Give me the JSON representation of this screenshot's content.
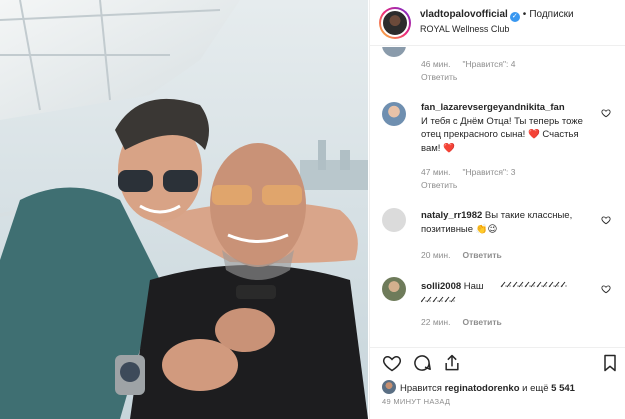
{
  "header": {
    "username": "vladtopalovofficial",
    "verified_mark": "✓",
    "dot": "•",
    "follow_label": "Подписки",
    "location": "ROYAL Wellness Club"
  },
  "comments": [
    {
      "username": "",
      "text": "",
      "time": "46 мин.",
      "likes": "\"Нравится\": 4",
      "reply": "Ответить",
      "avatar_color": "#8a9bab"
    },
    {
      "username": "fan_lazarevsergeyandnikita_fan",
      "text": "И тебя с Днём Отца! Ты теперь тоже отец прекрасного сына! ❤️ Счастья вам! ❤️",
      "time": "47 мин.",
      "likes": "\"Нравится\": 3",
      "reply": "Ответить",
      "avatar_color": "#6f8fb0"
    },
    {
      "username": "nataly_rr1982",
      "text": "Вы такие классные, позитивные 👏😉",
      "time": "20 мин.",
      "likes": "",
      "reply": "Ответить",
      "avatar_color": "#dbdbdb"
    },
    {
      "username": "solli2008",
      "text": "Наш",
      "time": "22 мин.",
      "likes": "",
      "reply": "Ответить",
      "avatar_color": "#6e7b5a"
    }
  ],
  "actions": {
    "like_icon": "heart-icon",
    "comment_icon": "comment-icon",
    "share_icon": "share-icon",
    "save_icon": "bookmark-icon"
  },
  "likes_line": {
    "prefix": "Нравится",
    "user": "reginatodorenko",
    "middle": "и ещё",
    "count": "5 541"
  },
  "time_ago": "49 МИНУТ НАЗАД",
  "colors": {
    "accent": "#3897f0",
    "text": "#262626",
    "muted": "#8e8e8e",
    "border": "#efefef"
  }
}
